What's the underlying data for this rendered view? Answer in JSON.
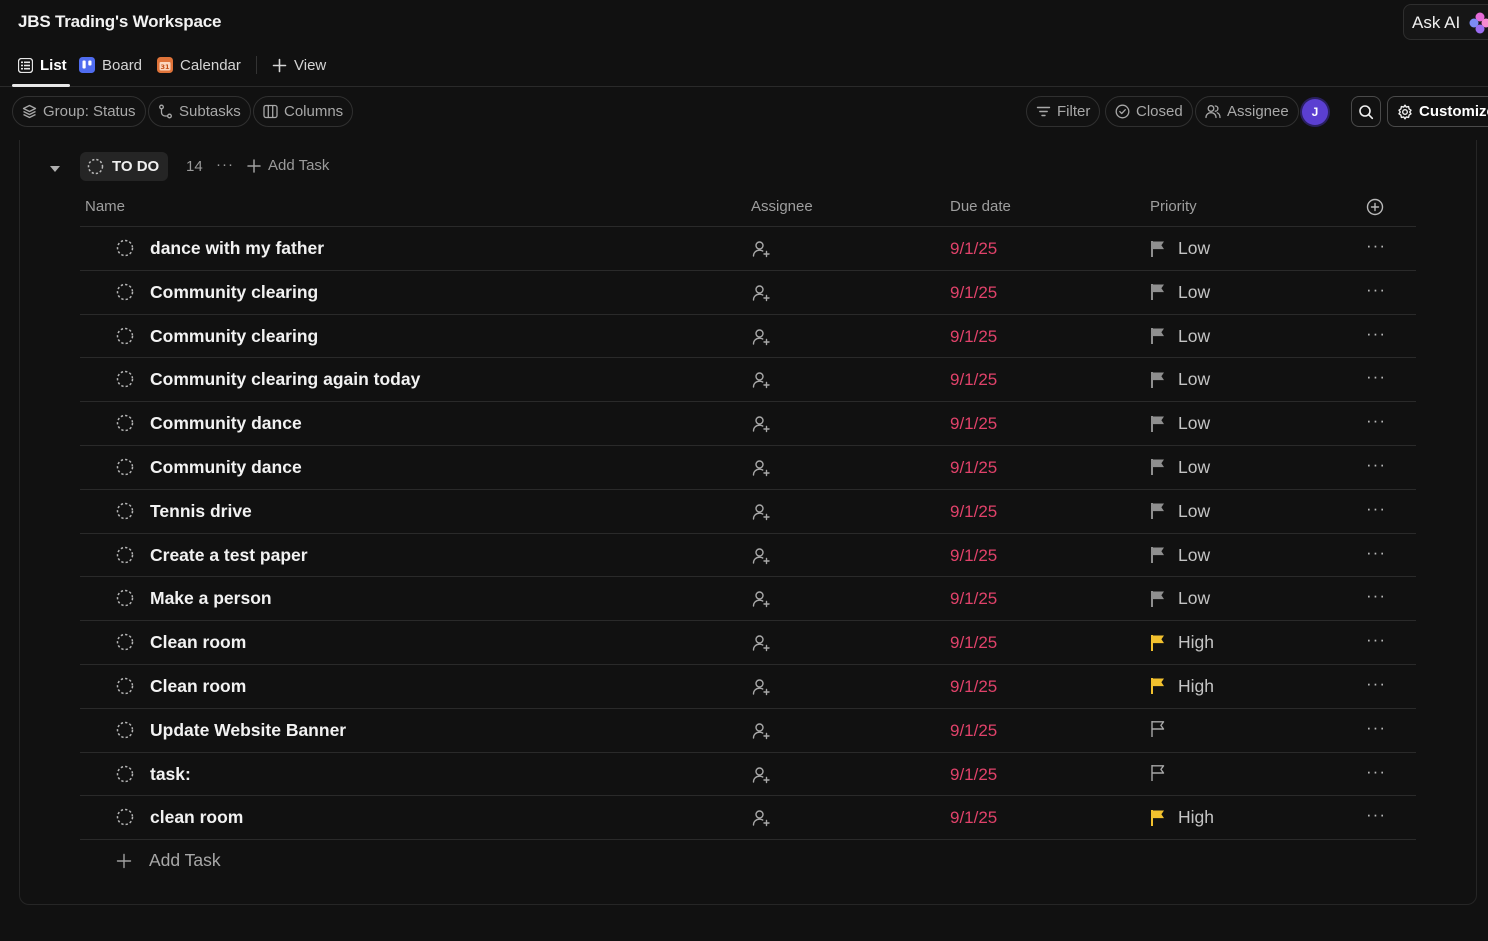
{
  "workspace": {
    "title": "JBS Trading's Workspace"
  },
  "ask_ai": {
    "label": "Ask AI",
    "icon": "sparkle-icon"
  },
  "tabs": [
    {
      "label": "List",
      "icon": "list-icon",
      "active": true
    },
    {
      "label": "Board",
      "icon": "board-icon",
      "active": false
    },
    {
      "label": "Calendar",
      "icon": "calendar-icon",
      "active": false
    },
    {
      "label": "View",
      "icon": "plus-icon",
      "active": false
    }
  ],
  "toolbar": {
    "group_label": "Group: Status",
    "subtasks_label": "Subtasks",
    "columns_label": "Columns",
    "filter_label": "Filter",
    "closed_label": "Closed",
    "assignee_label": "Assignee",
    "avatar_initial": "J",
    "customize_label": "Customize"
  },
  "group": {
    "status": "TO DO",
    "count": "14",
    "more": "···",
    "add_task_label": "Add Task"
  },
  "columns": {
    "name": "Name",
    "assignee": "Assignee",
    "due": "Due date",
    "priority": "Priority"
  },
  "colors": {
    "background": "#111111",
    "due_date": "#e0426a",
    "flag_low": "#8f8f8f",
    "flag_high": "#f2c12e",
    "avatar": "#5b3fd1"
  },
  "tasks": [
    {
      "name": "dance with my father",
      "due": "9/1/25",
      "priority": "Low"
    },
    {
      "name": "Community clearing",
      "due": "9/1/25",
      "priority": "Low"
    },
    {
      "name": "Community clearing",
      "due": "9/1/25",
      "priority": "Low"
    },
    {
      "name": "Community clearing again today",
      "due": "9/1/25",
      "priority": "Low"
    },
    {
      "name": "Community dance",
      "due": "9/1/25",
      "priority": "Low"
    },
    {
      "name": "Community dance",
      "due": "9/1/25",
      "priority": "Low"
    },
    {
      "name": "Tennis drive",
      "due": "9/1/25",
      "priority": "Low"
    },
    {
      "name": "Create a test paper",
      "due": "9/1/25",
      "priority": "Low"
    },
    {
      "name": "Make a person",
      "due": "9/1/25",
      "priority": "Low"
    },
    {
      "name": "Clean room",
      "due": "9/1/25",
      "priority": "High"
    },
    {
      "name": "Clean room",
      "due": "9/1/25",
      "priority": "High"
    },
    {
      "name": "Update Website Banner",
      "due": "9/1/25",
      "priority": ""
    },
    {
      "name": "task:",
      "due": "9/1/25",
      "priority": ""
    },
    {
      "name": "clean room",
      "due": "9/1/25",
      "priority": "High"
    }
  ],
  "footer": {
    "add_task_label": "Add Task"
  }
}
